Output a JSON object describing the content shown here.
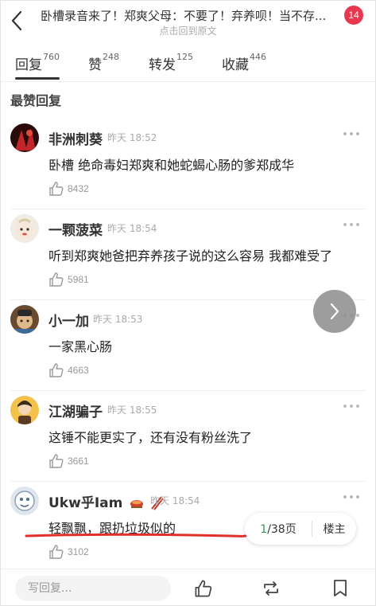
{
  "header": {
    "title": "卧槽录音来了！郑爽父母：不要了！弃养呗！当不存...",
    "subtitle": "点击回到原文",
    "badge": "14"
  },
  "tabs": [
    {
      "label": "回复",
      "count": "760"
    },
    {
      "label": "赞",
      "count": "248"
    },
    {
      "label": "转发",
      "count": "125"
    },
    {
      "label": "收藏",
      "count": "446"
    }
  ],
  "section_title": "最赞回复",
  "comments": [
    {
      "username": "非洲刺葵",
      "time": "昨天 18:52",
      "content": "卧槽 绝命毒妇郑爽和她蛇蝎心肠的爹郑成华",
      "likes": "8432"
    },
    {
      "username": "一颗菠菜",
      "time": "昨天 18:54",
      "content": "听到郑爽她爸把弃养孩子说的这么容易 我都难受了",
      "likes": "5981"
    },
    {
      "username": "小一加",
      "time": "昨天 18:53",
      "content": "一家黑心肠",
      "likes": "4663"
    },
    {
      "username": "江湖骗子",
      "time": "昨天 18:55",
      "content": "这锤不能更实了，还有没有粉丝洗了",
      "likes": "3661"
    },
    {
      "username": "Ukw乎Iam",
      "time": "昨天 18:54",
      "content": "轻飘飘，跟扔垃圾似的",
      "likes": "3102"
    }
  ],
  "pager": {
    "current": "1",
    "total": "/38页",
    "owner_label": "楼主"
  },
  "bottom_bar": {
    "reply_placeholder": "写回复..."
  },
  "colors": {
    "accent_green": "#2a9c5a",
    "badge_red": "#e8384f",
    "annotation_red": "#e0302a"
  }
}
